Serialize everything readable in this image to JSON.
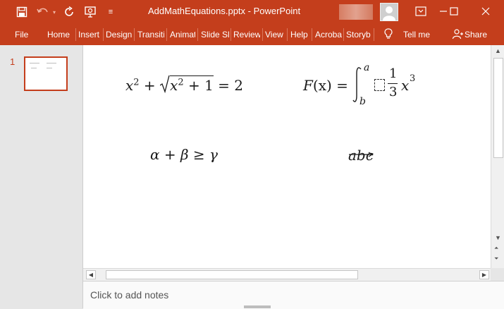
{
  "titlebar": {
    "title": "AddMathEquations.pptx  -  PowerPoint",
    "icons": [
      "save-icon",
      "undo-icon",
      "redo-icon",
      "present-icon",
      "customize-icon"
    ],
    "window_controls": [
      "ribbon-display-icon",
      "minimize-icon",
      "maximize-icon",
      "close-icon"
    ]
  },
  "ribbon": {
    "tabs": [
      "File",
      "Home",
      "Insert",
      "Design",
      "Transiti",
      "Animat",
      "Slide Sl",
      "Review",
      "View",
      "Help",
      "Acroba",
      "Storyb",
      "Tell me"
    ],
    "share": "Share"
  },
  "slides_panel": {
    "slide_number": "1"
  },
  "slide": {
    "eq1": {
      "x": "x",
      "exp": "2",
      "plus": "+",
      "rad": "x",
      "rad_exp": "2",
      "plus1": "+ 1",
      "equals": "= 2"
    },
    "eq2": {
      "F": "F",
      "paren": "(x)",
      "equals": "=",
      "upper": "a",
      "lower": "b",
      "num": "1",
      "den": "3",
      "x": "x",
      "exp": "3"
    },
    "eq3": {
      "text": "α + β ≥ γ"
    },
    "eq4": {
      "text": "abc"
    }
  },
  "notes": {
    "placeholder": "Click to add notes"
  },
  "colors": {
    "accent": "#c43e1c"
  }
}
